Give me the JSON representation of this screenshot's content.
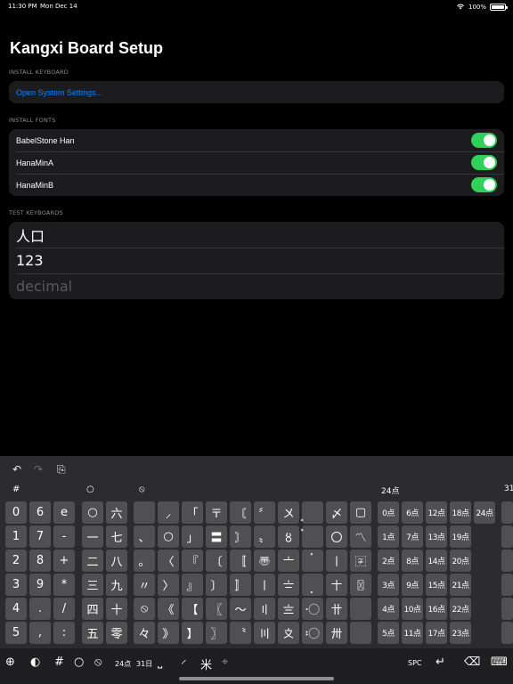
{
  "status": {
    "time": "11:30 PM",
    "date": "Mon Dec 14",
    "battery": "100%"
  },
  "title": "Kangxi Board Setup",
  "sections": {
    "install_keyboard": {
      "header": "INSTALL KEYBOARD",
      "link": "Open System Settings..."
    },
    "install_fonts": {
      "header": "INSTALL FONTS",
      "fonts": [
        {
          "name": "BabelStone Han",
          "enabled": true
        },
        {
          "name": "HanaMinA",
          "enabled": true
        },
        {
          "name": "HanaMinB",
          "enabled": true
        }
      ]
    },
    "test_keyboards": {
      "header": "TEST KEYBOARDS",
      "fields": [
        {
          "value": "人口",
          "placeholder": ""
        },
        {
          "value": "123",
          "placeholder": ""
        },
        {
          "value": "",
          "placeholder": "decimal"
        }
      ]
    }
  },
  "keyboard": {
    "toolbar": {
      "undo_icon": "↶",
      "redo_icon": "↷",
      "paste_icon": "⎘"
    },
    "column_labels": {
      "hash": "#",
      "circle": "○",
      "circled": "⦸",
      "pts24": "24点",
      "pts31": "31"
    },
    "col1": [
      "0",
      "1",
      "2",
      "3",
      "4",
      "5"
    ],
    "col2": [
      "6",
      "7",
      "8",
      "9",
      ".",
      ","
    ],
    "col3": [
      "e",
      "-",
      "+",
      "*",
      "/",
      ":"
    ],
    "col4": [
      "○",
      "一",
      "二",
      "三",
      "四",
      "五"
    ],
    "col5": [
      "六",
      "七",
      "八",
      "九",
      "十",
      "零"
    ],
    "col6": [
      "",
      "、",
      "。",
      "〃",
      "⦸",
      "々"
    ],
    "col7": [
      "⸝",
      "○",
      "〈",
      "〉",
      "《",
      "》"
    ],
    "col8": [
      "「",
      "」",
      "『",
      "』",
      "【",
      "】"
    ],
    "col9": [
      "〒",
      "〓",
      "〔",
      "〕",
      "〖",
      "〗"
    ],
    "col10": [
      "〘",
      "〙",
      "〚",
      "〛",
      "〜",
      "〝"
    ],
    "col11": [
      "〞",
      "〟",
      "〠",
      "〡",
      "〢",
      "〣"
    ],
    "col12": [
      "〤",
      "〥",
      "〦",
      "〧",
      "〨",
      "〩"
    ],
    "col13": [
      "〪",
      "〫",
      "〬",
      "〭",
      "〮",
      "〯"
    ],
    "col14": [
      "〆",
      "〇",
      "〡",
      "〸",
      "〹",
      "〺"
    ],
    "col15": [
      "▢",
      "〽",
      "〾",
      "〿",
      "",
      ""
    ],
    "pts_a": [
      "0点",
      "1点",
      "2点",
      "3点",
      "4点",
      "5点"
    ],
    "pts_b": [
      "6点",
      "7点",
      "8点",
      "9点",
      "10点",
      "11点"
    ],
    "pts_c": [
      "12点",
      "13点",
      "14点",
      "15点",
      "16点",
      "17点"
    ],
    "pts_d": [
      "18点",
      "19点",
      "20点",
      "21点",
      "22点",
      "23点"
    ],
    "pts_e": [
      "24点"
    ],
    "bottom": {
      "globe": "⊕",
      "toggle": "◐",
      "hash": "#",
      "circle": "○",
      "circled": "⦸",
      "pts24": "24点",
      "day31": "31日",
      "bracket": "⎵",
      "slash": "⸍",
      "star": "米",
      "cross": "⌖",
      "space": "SPC",
      "return": "↵",
      "delete": "⌫",
      "hide": "⌨"
    }
  }
}
